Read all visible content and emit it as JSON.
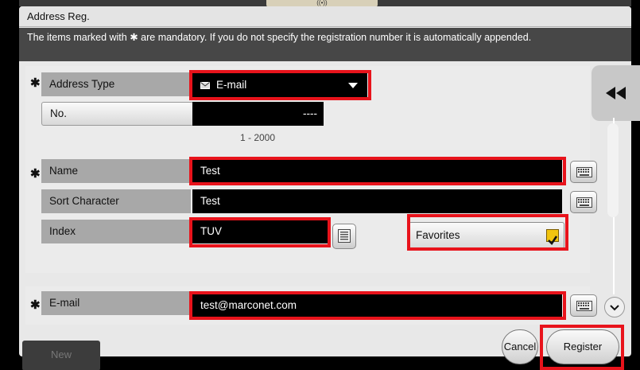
{
  "header": {
    "handle_text": "((•))",
    "title": "Address Reg.",
    "info": "The items marked with ✱ are mandatory. If you do not specify the registration number it is automatically appended."
  },
  "mandatory_mark": "✱",
  "fields": {
    "address_type": {
      "label": "Address Type",
      "value": "E-mail"
    },
    "number": {
      "label": "No.",
      "value": "----",
      "range": "1 - 2000"
    },
    "name": {
      "label": "Name",
      "value": "Test"
    },
    "sort_character": {
      "label": "Sort Character",
      "value": "Test"
    },
    "index": {
      "label": "Index",
      "value": "TUV"
    },
    "favorites": {
      "label": "Favorites",
      "checked": true
    },
    "email": {
      "label": "E-mail",
      "value": "test@marconet.com"
    }
  },
  "buttons": {
    "collapse": "◀◀",
    "new": "New",
    "cancel": "Cancel",
    "register": "Register"
  },
  "colors": {
    "highlight": "#e8131b",
    "field_bg": "#000000",
    "label_bg": "#a8a8a8",
    "info_bg": "#474747",
    "checkbox": "#f1c40f"
  }
}
